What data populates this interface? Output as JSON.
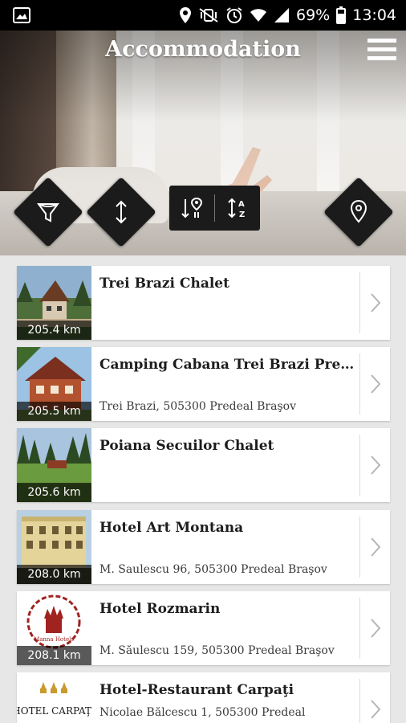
{
  "status_bar": {
    "battery": "69%",
    "time": "13:04"
  },
  "header": {
    "title": "Accommodation"
  },
  "toolbar": {
    "filter_icon": "filter-funnel-icon",
    "sort_icon": "sort-updown-icon",
    "sort_distance_icon": "sort-distance-icon",
    "sort_alpha_icon": "sort-alpha-icon",
    "map_icon": "map-pin-icon"
  },
  "listings": [
    {
      "name": "Trei Brazi Chalet",
      "address": "",
      "distance": "205.4 km"
    },
    {
      "name": "Camping Cabana Trei Brazi Predeal",
      "address": "Trei Brazi, 505300 Predeal Braşov",
      "distance": "205.5 km"
    },
    {
      "name": "Poiana Secuilor Chalet",
      "address": "",
      "distance": "205.6 km"
    },
    {
      "name": "Hotel Art Montana",
      "address": "M. Saulescu 96, 505300 Predeal Braşov",
      "distance": "208.0 km"
    },
    {
      "name": "Hotel Rozmarin",
      "address": "M. Săulescu 159, 505300 Predeal Braşov",
      "distance": "208.1 km"
    },
    {
      "name": "Hotel-Restaurant Carpaţi",
      "address": "Nicolae Bălcescu 1, 505300 Predeal",
      "distance": ""
    }
  ],
  "thumb_logos": {
    "rozmarin_logo": "Manna Hotels",
    "carpati_logo": "HOTEL CARPAŢI"
  },
  "colors": {
    "accent_dark": "#1b1b1b",
    "list_background": "#e7e7e7"
  }
}
